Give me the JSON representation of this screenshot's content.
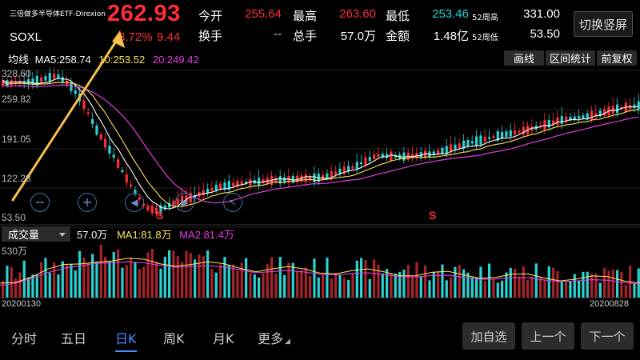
{
  "header": {
    "fund_name": "三倍做多半导体ETF-Direxion",
    "ticker": "SOXL",
    "price": "262.93",
    "change_pct": "3.72%",
    "change_abs": "9.44"
  },
  "quote": {
    "open_label": "今开",
    "open_value": "255.64",
    "high_label": "最高",
    "high_value": "263.60",
    "low_label": "最低",
    "low_value": "253.46",
    "w52high_label": "52周高",
    "w52high_value": "331.00",
    "turnover_label": "换手",
    "turnover_value": "--",
    "volume_label": "总手",
    "volume_value": "57.0万",
    "amount_label": "金额",
    "amount_value": "1.48亿",
    "w52low_label": "52周低",
    "w52low_value": "53.50"
  },
  "switch_button": "切换竖屏",
  "ma": {
    "label": "均线",
    "ma5": "MA5:258.74",
    "ma10": "10:253.52",
    "ma20": "20:249.42"
  },
  "tools": {
    "line": "画线",
    "range_stats": "区间统计",
    "adjust": "前复权"
  },
  "price_axis": [
    "328.60",
    "259.82",
    "191.05",
    "122.28",
    "53.50"
  ],
  "s_markers": [
    "S",
    "S"
  ],
  "volume": {
    "select_label": "成交量",
    "total": "57.0万",
    "ma1": "MA1:81.8万",
    "ma2": "MA2:81.4万",
    "axis_max": "530万"
  },
  "dates": {
    "start": "20200130",
    "end": "20200828"
  },
  "tabs": [
    "分时",
    "五日",
    "日K",
    "周K",
    "月K",
    "更多"
  ],
  "bottom_buttons": {
    "add_watch": "加自选",
    "prev": "上一个",
    "next": "下一个"
  },
  "colors": {
    "up": "#ff2d36",
    "down": "#2ad2d2",
    "ma5": "#ffffff",
    "ma10": "#ffe55c",
    "ma20": "#e23ee0",
    "arrow": "#f3c14a",
    "accent": "#4a8cff"
  }
}
